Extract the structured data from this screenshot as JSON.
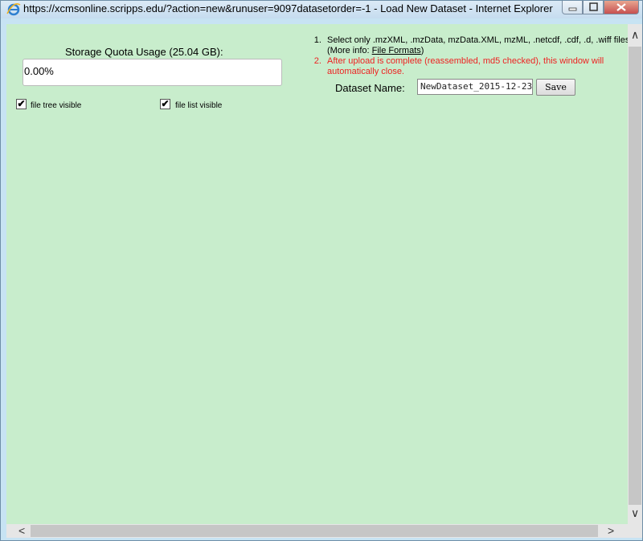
{
  "window": {
    "title": "https://xcmsonline.scripps.edu/?action=new&runuser=9097datasetorder=-1 - Load New Dataset - Internet Explorer"
  },
  "quota": {
    "label": "Storage Quota Usage (25.04 GB):",
    "value": "0.00%"
  },
  "options": {
    "file_tree_label": "file tree visible",
    "file_tree_checked": true,
    "file_list_label": "file list visible",
    "file_list_checked": true,
    "check_mark": "✔"
  },
  "instructions": {
    "item1_text": "Select only .mzXML, .mzData, mzData.XML, mzML, .netcdf, .cdf, .d, .wiff files (More info: ",
    "item1_link": "File Formats",
    "item1_end": ")",
    "item2_text": "After upload is complete (reassembled, md5 checked), this window will automatically close."
  },
  "dataset": {
    "label": "Dataset Name:",
    "value": "NewDataset_2015-12-23",
    "save_label": "Save"
  },
  "scrollbars": {
    "up": "∧",
    "down": "∨",
    "left": "<",
    "right": ">"
  }
}
